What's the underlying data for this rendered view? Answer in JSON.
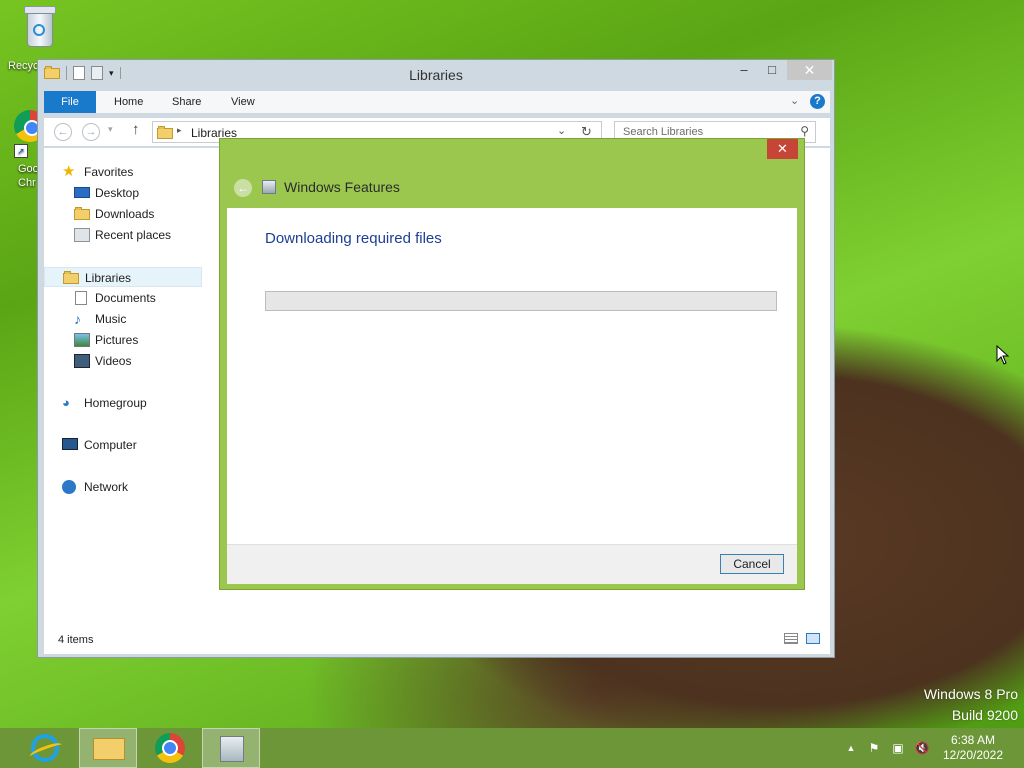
{
  "desktop": {
    "icons": [
      {
        "label": "Recycle Bin",
        "visible_label": "Recyc"
      },
      {
        "label_line1": "Goo",
        "label_line2": "Chr"
      }
    ],
    "watermark": {
      "line1": "Windows 8 Pro",
      "line2": "Build 9200"
    }
  },
  "explorer": {
    "title": "Libraries",
    "ribbon_tabs": {
      "file": "File",
      "home": "Home",
      "share": "Share",
      "view": "View"
    },
    "address": {
      "path": "Libraries"
    },
    "search": {
      "placeholder": "Search Libraries"
    },
    "nav": {
      "favorites": "Favorites",
      "desktop": "Desktop",
      "downloads": "Downloads",
      "recent": "Recent places",
      "libraries": "Libraries",
      "documents": "Documents",
      "music": "Music",
      "pictures": "Pictures",
      "videos": "Videos",
      "homegroup": "Homegroup",
      "computer": "Computer",
      "network": "Network"
    },
    "status": {
      "items": "4 items"
    }
  },
  "dialog": {
    "title": "Windows Features",
    "heading": "Downloading required files",
    "progress": 0,
    "cancel_label": "Cancel",
    "accent_color": "#9cc74f"
  },
  "taskbar": {
    "clock": {
      "time": "6:38 AM",
      "date": "12/20/2022"
    },
    "tray_icons": [
      "show-hidden-icons",
      "action-center-icon",
      "network-icon",
      "volume-muted-icon"
    ]
  }
}
